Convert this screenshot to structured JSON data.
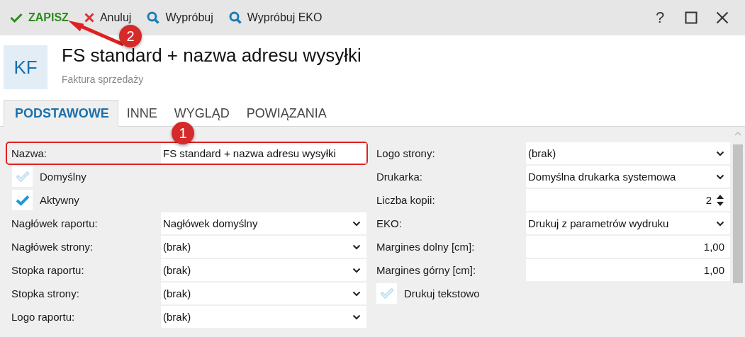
{
  "toolbar": {
    "buttons": [
      {
        "label": "ZAPISZ",
        "kind": "save"
      },
      {
        "label": "Anuluj",
        "kind": "cancel"
      },
      {
        "label": "Wypróbuj",
        "kind": "search"
      },
      {
        "label": "Wypróbuj EKO",
        "kind": "search"
      }
    ],
    "window_controls": [
      {
        "label": "?",
        "kind": "help"
      },
      {
        "kind": "maximize"
      },
      {
        "kind": "close"
      }
    ]
  },
  "header": {
    "badge": "KF",
    "title": "FS standard + nazwa adresu wysyłki",
    "subtitle": "Faktura sprzedaży"
  },
  "tabs": [
    {
      "label": "PODSTAWOWE",
      "selected": true
    },
    {
      "label": "INNE",
      "selected": false
    },
    {
      "label": "WYGLĄD",
      "selected": false
    },
    {
      "label": "POWIĄZANIA",
      "selected": false
    }
  ],
  "left_fields": [
    {
      "kind": "text",
      "label": "Nazwa:",
      "value": "FS standard + nazwa adresu wysyłki",
      "highlighted": true
    },
    {
      "kind": "checkbox",
      "label": "Domyślny",
      "checked": false
    },
    {
      "kind": "checkbox",
      "label": "Aktywny",
      "checked": true
    },
    {
      "kind": "select",
      "label": "Nagłówek raportu:",
      "value": "Nagłówek domyślny"
    },
    {
      "kind": "select",
      "label": "Nagłówek strony:",
      "value": "(brak)"
    },
    {
      "kind": "select",
      "label": "Stopka raportu:",
      "value": "(brak)"
    },
    {
      "kind": "select",
      "label": "Stopka strony:",
      "value": "(brak)"
    },
    {
      "kind": "select",
      "label": "Logo raportu:",
      "value": "(brak)"
    }
  ],
  "right_fields": [
    {
      "kind": "select",
      "label": "Logo strony:",
      "value": "(brak)"
    },
    {
      "kind": "select",
      "label": "Drukarka:",
      "value": "Domyślna drukarka systemowa"
    },
    {
      "kind": "spinner",
      "label": "Liczba kopii:",
      "value": "2"
    },
    {
      "kind": "select",
      "label": "EKO:",
      "value": "Drukuj z parametrów wydruku"
    },
    {
      "kind": "number",
      "label": "Margines dolny [cm]:",
      "value": "1,00"
    },
    {
      "kind": "number",
      "label": "Margines górny [cm]:",
      "value": "1,00"
    },
    {
      "kind": "checkbox",
      "label": "Drukuj tekstowo",
      "checked": false
    }
  ],
  "annotations": [
    {
      "label": "1",
      "arrow": false
    },
    {
      "label": "2",
      "arrow": true
    }
  ]
}
